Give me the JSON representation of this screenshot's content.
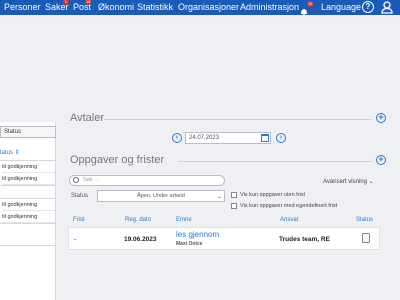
{
  "nav": {
    "items": [
      {
        "label": "Personer"
      },
      {
        "label": "Saker",
        "badge": "1"
      },
      {
        "label": "Post",
        "badge": "18"
      },
      {
        "label": "Økonomi"
      },
      {
        "label": "Statistikk"
      },
      {
        "label": "Organisasjoner"
      },
      {
        "label": "Administrasjon"
      }
    ],
    "bell_badge": "18",
    "language": "Language",
    "help_glyph": "?",
    "icons": [
      "bell-icon",
      "help-icon",
      "user-icon"
    ]
  },
  "left": {
    "status_select": "Status",
    "status_label": "tatus ⇕",
    "card_items": [
      "til godkjenning",
      "til godkjenning",
      "til godkjenning",
      "til godkjenning"
    ]
  },
  "avtaler": {
    "title": "Avtaler",
    "date": "24.07.2023",
    "prev_glyph": "‹",
    "next_glyph": "›",
    "plus_glyph": "+"
  },
  "tasks": {
    "title": "Oppgaver og frister",
    "plus_glyph": "+",
    "search_placeholder": "Søk ...",
    "advanced_view": "Avansert visning ⌄",
    "status_label": "Status",
    "status_value": "Åpen, Under arbeid",
    "checkbox_no_deadline": "Vis kun oppgaver uten frist",
    "checkbox_custom_deadline": "Vis kun oppgaver med egendefinert frist",
    "columns": [
      "Frist",
      "Reg. dato",
      "Emne",
      "Ansvar",
      "Status"
    ],
    "rows": [
      {
        "frist": "-",
        "reg_dato": "19.06.2023",
        "emne": "les gjennom",
        "emne_sub": "Maxi Onice",
        "ansvar": "Trudes team, RE"
      }
    ]
  },
  "colors": {
    "nav": "#1a5bb8",
    "accent": "#2a7bd6",
    "badge": "#d9342b"
  }
}
